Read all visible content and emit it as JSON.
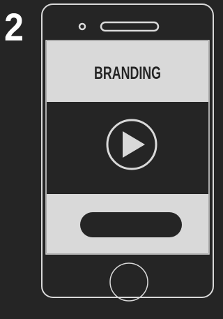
{
  "step": {
    "number": "2"
  },
  "phone": {
    "banner": {
      "text": "BRANDING"
    },
    "video": {
      "icon": "play-icon"
    },
    "cta": {
      "icon": "pill-button"
    },
    "home_button": {
      "icon": "home-button-icon"
    }
  },
  "colors": {
    "background": "#252525",
    "outline": "#d9d9d9",
    "panel": "#d9d9d9",
    "text": "#ffffff",
    "dark": "#252525"
  }
}
